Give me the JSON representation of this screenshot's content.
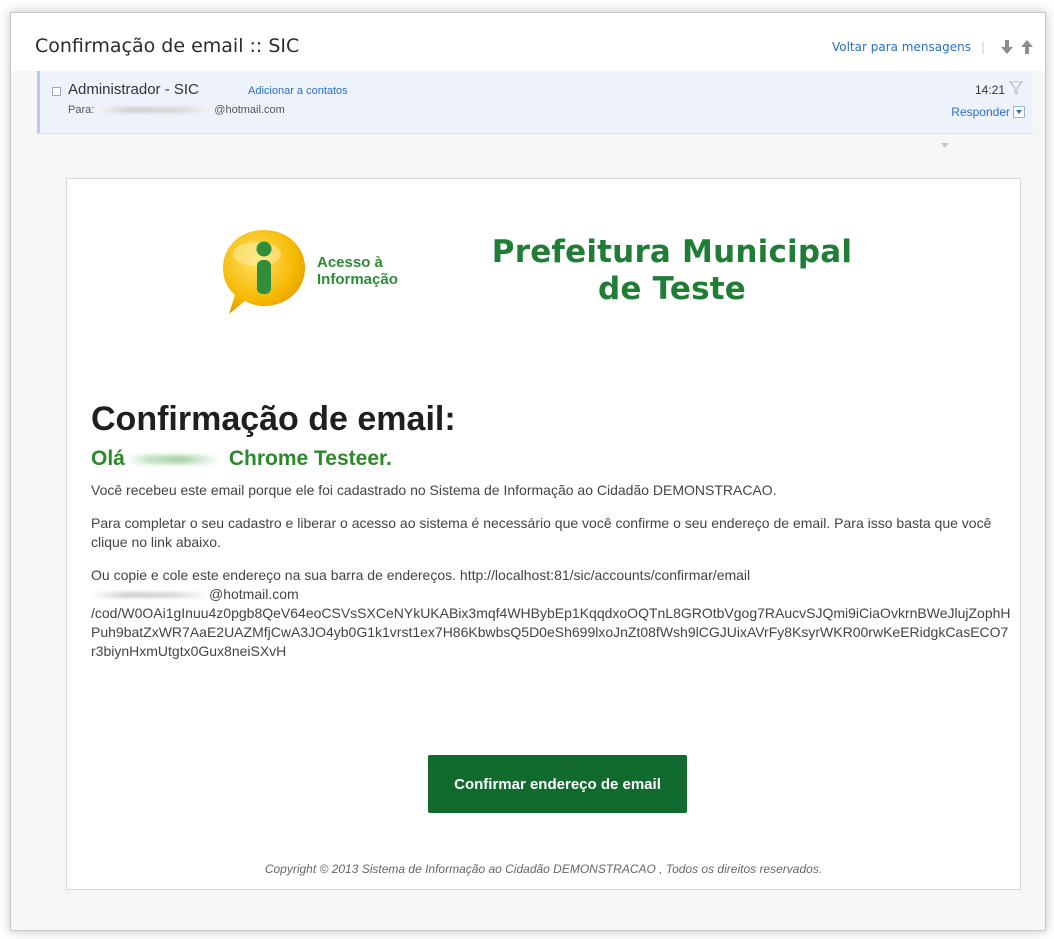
{
  "topbar": {
    "subject": "Confirmação de email :: SIC",
    "back_link": "Voltar para mensagens",
    "sep": "|"
  },
  "message": {
    "sender": "Administrador - SIC",
    "add_contact": "Adicionar a contatos",
    "recipient_prefix": "Para:",
    "recipient_suffix": "@hotmail.com",
    "time": "14:21",
    "reply": "Responder"
  },
  "email": {
    "logo_text_line1": "Acesso à",
    "logo_text_line2": "Informação",
    "org_line1": "Prefeitura Municipal",
    "org_line2": "de Teste",
    "heading": "Confirmação de email:",
    "greeting_start": "Olá",
    "greeting_end": "Chrome Testeer.",
    "para1": "Você recebeu este email porque ele foi cadastrado no Sistema de Informação ao Cidadão DEMONSTRACAO.",
    "para2": "Para completar o seu cadastro e liberar o acesso ao sistema é necessário que você confirme o seu endereço de email. Para isso basta que você clique no link abaixo.",
    "para3_start": "Ou copie e cole este endereço na sua barra de endereços. http://localhost:81/sic/accounts/confirmar/email",
    "para3_email_suffix": "@hotmail.com",
    "para3_token": "/cod/W0OAi1gInuu4z0pgb8QeV64eoCSVsSXCeNYkUKABix3mqf4WHBybEp1KqqdxoOQTnL8GROtbVgog7RAucvSJQmi9iCiaOvkrnBWeJlujZophHPuh9batZxWR7AaE2UAZMfjCwA3JO4yb0G1k1vrst1ex7H86KbwbsQ5D0eSh699lxoJnZt08fWsh9lCGJUixAVrFy8KsyrWKR00rwKeERidgkCasECO7r3biynHxmUtgtx0Gux8neiSXvH",
    "confirm_button": "Confirmar endereço de email",
    "copyright": "Copyright © 2013 Sistema de Informação ao Cidadão DEMONSTRACAO , Todos os direitos reservados."
  },
  "colors": {
    "accent_green": "#1f7d35",
    "button_green": "#126b2e",
    "link_blue": "#2a6fc9",
    "header_bg": "#eef3fb"
  }
}
